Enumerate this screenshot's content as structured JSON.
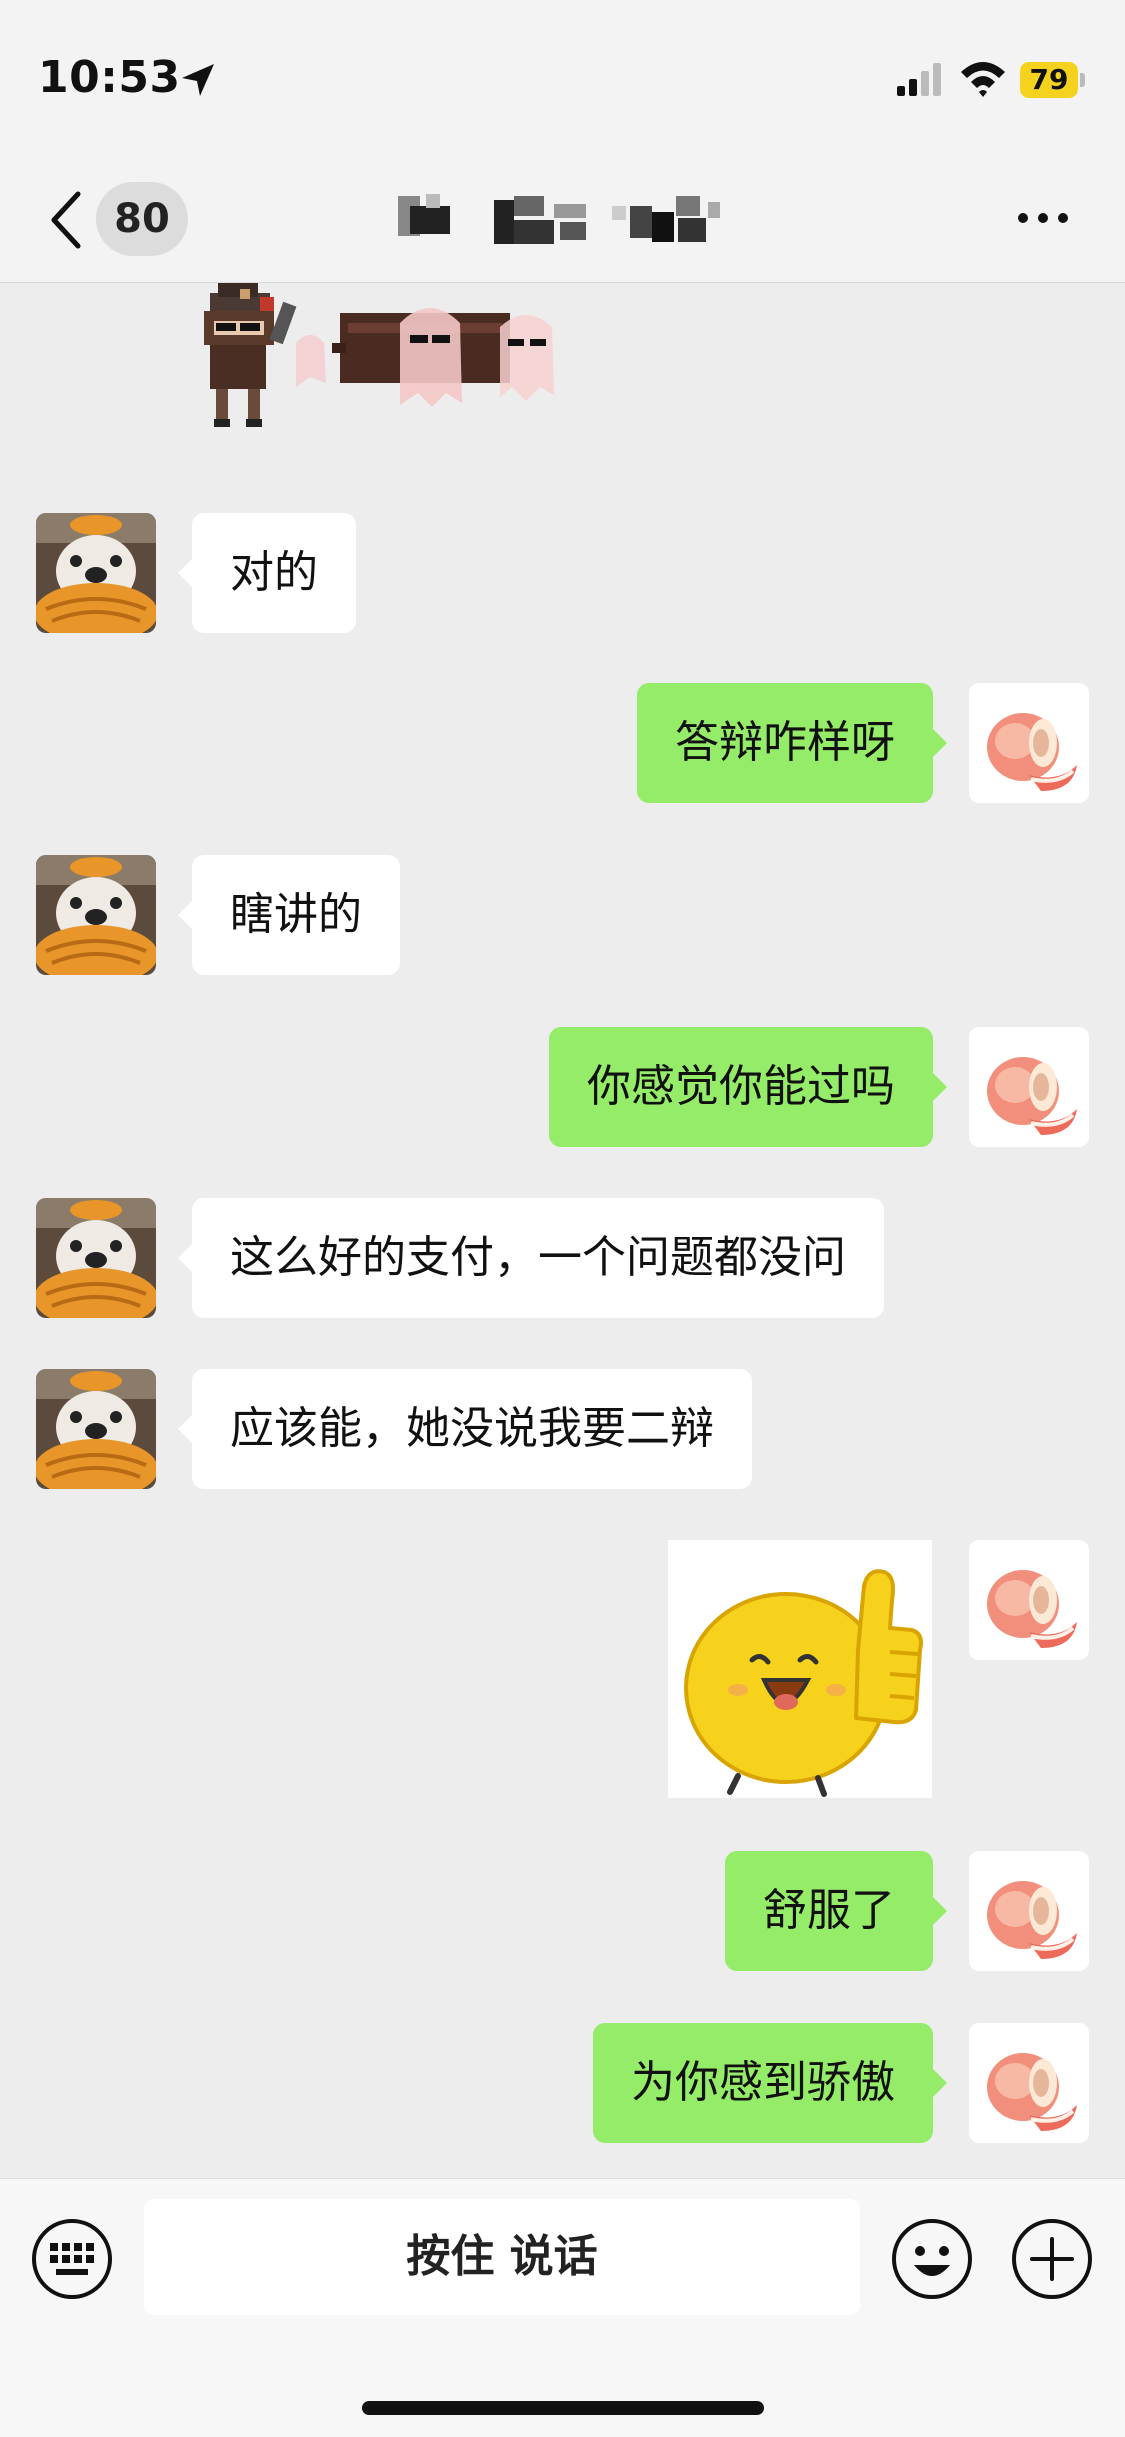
{
  "status_bar": {
    "time": "10:53",
    "battery": "79"
  },
  "nav": {
    "unread_count": "80",
    "title": ""
  },
  "messages": [
    {
      "side": "left",
      "text": "对的"
    },
    {
      "side": "right",
      "text": "答辩咋样呀"
    },
    {
      "side": "left",
      "text": "瞎讲的"
    },
    {
      "side": "right",
      "text": "你感觉你能过吗"
    },
    {
      "side": "left",
      "text": "这么好的支付，一个问题都没问"
    },
    {
      "side": "left",
      "text": "应该能，她没说我要二辩"
    },
    {
      "side": "right",
      "type": "sticker",
      "sticker": "thumbs-up-smiley"
    },
    {
      "side": "right",
      "text": "舒服了"
    },
    {
      "side": "right",
      "text": "为你感到骄傲"
    }
  ],
  "input": {
    "voice_label": "按住 说话"
  },
  "icons": {
    "back": "chevron-left-icon",
    "more": "more-icon",
    "keyboard": "keyboard-icon",
    "emoji": "emoji-icon",
    "plus": "plus-icon"
  },
  "colors": {
    "sent_bubble": "#95ec69",
    "received_bubble": "#ffffff",
    "background": "#ededed",
    "battery": "#f5d21e"
  }
}
